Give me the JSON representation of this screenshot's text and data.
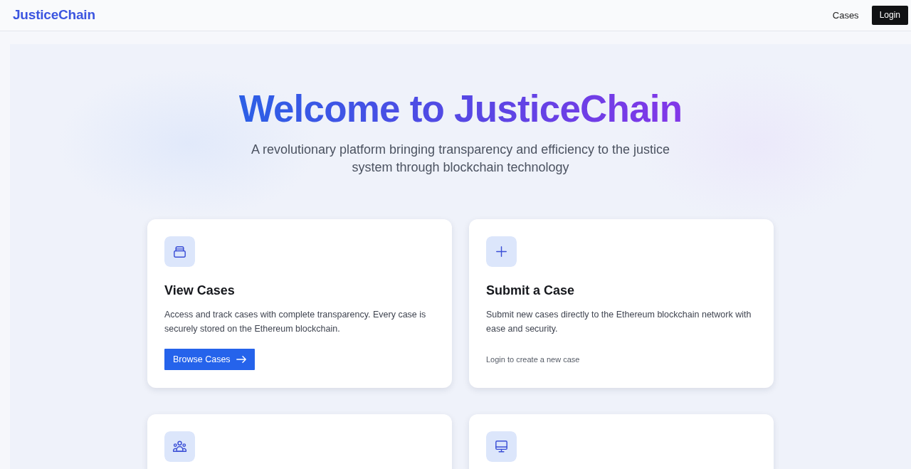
{
  "navbar": {
    "brand": "JusticeChain",
    "links": [
      {
        "kind": "link",
        "label": "Cases"
      },
      {
        "kind": "button",
        "label": "Login"
      }
    ]
  },
  "hero": {
    "title": "Welcome to JusticeChain",
    "subtitle": "A revolutionary platform bringing transparency and efficiency to the justice system through blockchain technology"
  },
  "features": [
    {
      "clipped": false,
      "title": "View Cases",
      "description": "Access and track cases with complete transparency. Every case is securely stored on the Ethereum blockchain.",
      "action": {
        "kind": "button",
        "label": "Browse Cases"
      }
    },
    {
      "clipped": false,
      "title": "Submit a Case",
      "description": "Submit new cases directly to the Ethereum blockchain network with ease and security.",
      "action": {
        "kind": "note",
        "label": "Login to create a new case"
      }
    },
    {
      "clipped": true
    },
    {
      "clipped": true
    }
  ]
}
